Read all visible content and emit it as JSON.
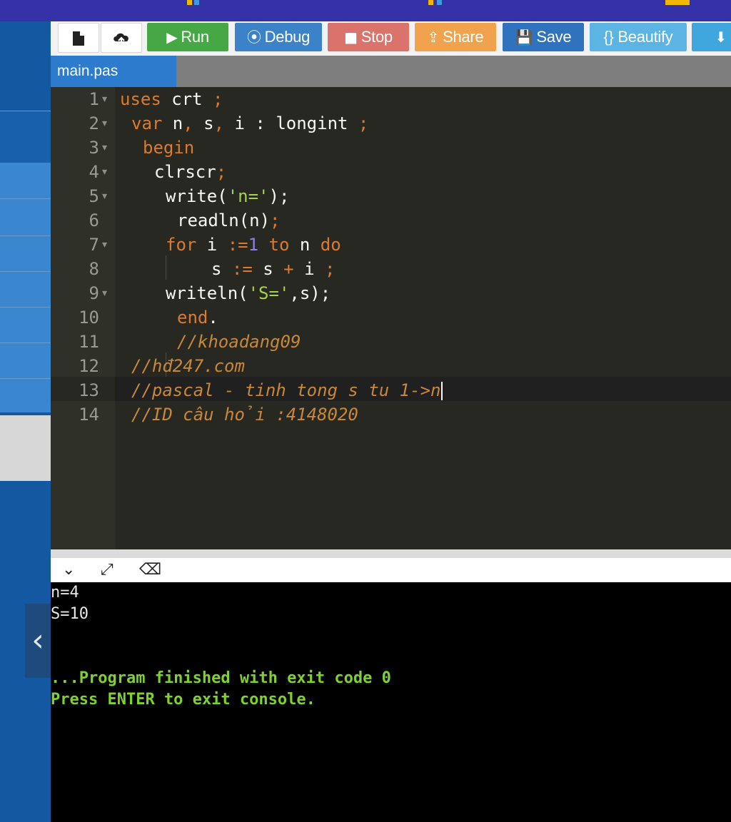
{
  "toolbar": {
    "run_label": "Run",
    "debug_label": "Debug",
    "stop_label": "Stop",
    "share_label": "Share",
    "save_label": "Save",
    "beautify_label": "{} Beautify",
    "icons": {
      "new_file": "file-icon",
      "upload": "upload-icon",
      "run": "play-icon",
      "debug": "debug-icon",
      "stop": "stop-icon",
      "share": "share-icon",
      "save": "save-icon",
      "download": "download-icon"
    }
  },
  "colors": {
    "run": "#45a845",
    "debug": "#3c82c9",
    "stop": "#d9736c",
    "share": "#f0a24c",
    "save": "#2f72bd",
    "beautify": "#5bb4e3",
    "download": "#3fa7dd"
  },
  "tab": {
    "label": "main.pas"
  },
  "editor": {
    "lines": [
      {
        "num": "1",
        "tokens": [
          {
            "t": "uses",
            "c": "k"
          },
          {
            "t": " crt ",
            "c": "n"
          },
          {
            "t": ";",
            "c": "p"
          }
        ]
      },
      {
        "num": "2",
        "tokens": [
          {
            "t": "var",
            "c": "k"
          },
          {
            "t": " n",
            "c": "n"
          },
          {
            "t": ",",
            "c": "p"
          },
          {
            "t": " s",
            "c": "n"
          },
          {
            "t": ",",
            "c": "p"
          },
          {
            "t": " i : longint ",
            "c": "n"
          },
          {
            "t": ";",
            "c": "p"
          }
        ]
      },
      {
        "num": "3",
        "tokens": [
          {
            "t": "begin",
            "c": "k"
          }
        ]
      },
      {
        "num": "4",
        "tokens": [
          {
            "t": "clrscr",
            "c": "n"
          },
          {
            "t": ";",
            "c": "p"
          }
        ]
      },
      {
        "num": "5",
        "tokens": [
          {
            "t": "write(",
            "c": "n"
          },
          {
            "t": "'n='",
            "c": "s"
          },
          {
            "t": ");",
            "c": "n"
          }
        ]
      },
      {
        "num": "6",
        "tokens": [
          {
            "t": "readln(n)",
            "c": "n"
          },
          {
            "t": ";",
            "c": "p"
          }
        ]
      },
      {
        "num": "7",
        "tokens": [
          {
            "t": "for",
            "c": "k"
          },
          {
            "t": " i ",
            "c": "n"
          },
          {
            "t": ":=",
            "c": "p"
          },
          {
            "t": "1",
            "c": "num"
          },
          {
            "t": " to",
            "c": "k"
          },
          {
            "t": " n ",
            "c": "n"
          },
          {
            "t": "do",
            "c": "k"
          }
        ]
      },
      {
        "num": "8",
        "tokens": [
          {
            "t": "s ",
            "c": "n"
          },
          {
            "t": ":=",
            "c": "p"
          },
          {
            "t": " s ",
            "c": "n"
          },
          {
            "t": "+",
            "c": "p"
          },
          {
            "t": " i ",
            "c": "n"
          },
          {
            "t": ";",
            "c": "p"
          }
        ]
      },
      {
        "num": "9",
        "tokens": [
          {
            "t": "writeln(",
            "c": "n"
          },
          {
            "t": "'S='",
            "c": "s"
          },
          {
            "t": ",s);",
            "c": "n"
          }
        ]
      },
      {
        "num": "10",
        "tokens": [
          {
            "t": "end",
            "c": "k"
          },
          {
            "t": ".",
            "c": "n"
          }
        ]
      },
      {
        "num": "11",
        "tokens": [
          {
            "t": "//khoadang09",
            "c": "c"
          }
        ]
      },
      {
        "num": "12",
        "tokens": [
          {
            "t": "//hđ247.com",
            "c": "c"
          }
        ]
      },
      {
        "num": "13",
        "tokens": [
          {
            "t": "//pascal - tinh tong s tu 1->n",
            "c": "c"
          }
        ]
      },
      {
        "num": "14",
        "tokens": [
          {
            "t": "//ID câu hỏi :4148020",
            "c": "c"
          }
        ]
      }
    ]
  },
  "console": {
    "lines": [
      {
        "text": "n=4",
        "kind": "out"
      },
      {
        "text": "S=10",
        "kind": "out"
      },
      {
        "text": "...Program finished with exit code 0",
        "kind": "ok"
      },
      {
        "text": "Press ENTER to exit console.",
        "kind": "ok"
      }
    ]
  }
}
